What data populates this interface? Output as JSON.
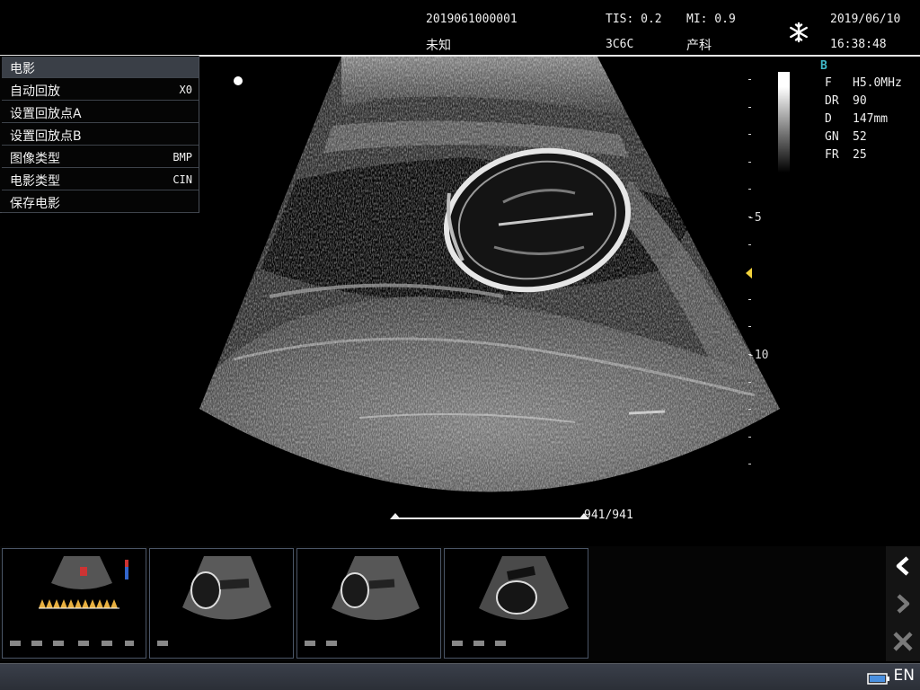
{
  "header": {
    "patient_id": "2019061000001",
    "patient_name": "未知",
    "tis": "TIS: 0.2",
    "mi": "MI: 0.9",
    "probe": "3C6C",
    "exam_type": "产科",
    "date": "2019/06/10",
    "time": "16:38:48",
    "freeze_icon": "snowflake-icon"
  },
  "cine_menu": {
    "title": "电影",
    "items": [
      {
        "label": "自动回放",
        "value": "X0"
      },
      {
        "label": "设置回放点A",
        "value": ""
      },
      {
        "label": "设置回放点B",
        "value": ""
      },
      {
        "label": "图像类型",
        "value": "BMP"
      },
      {
        "label": "电影类型",
        "value": "CIN"
      },
      {
        "label": "保存电影",
        "value": ""
      }
    ]
  },
  "params": {
    "mode": "B",
    "rows": [
      {
        "key": "F",
        "value": "H5.0MHz"
      },
      {
        "key": "DR",
        "value": "90"
      },
      {
        "key": "D",
        "value": "147mm"
      },
      {
        "key": "GN",
        "value": "52"
      },
      {
        "key": "FR",
        "value": "25"
      }
    ]
  },
  "depth_scale": {
    "label_5": "-5",
    "label_10": "-10"
  },
  "cine": {
    "frame": "941/941",
    "position": 1.0
  },
  "thumbnails": [
    {
      "kind": "doppler"
    },
    {
      "kind": "b-mode"
    },
    {
      "kind": "b-mode"
    },
    {
      "kind": "b-mode"
    }
  ],
  "nav": {
    "prev_icon": "chevron-left-icon",
    "next_icon": "chevron-right-icon",
    "close_icon": "close-icon"
  },
  "status": {
    "language": "EN",
    "battery_icon": "battery-icon"
  },
  "colors": {
    "mode_letter": "#3fb8c8",
    "focus_marker": "#f2d23c",
    "menu_header": "#3a3f47"
  }
}
